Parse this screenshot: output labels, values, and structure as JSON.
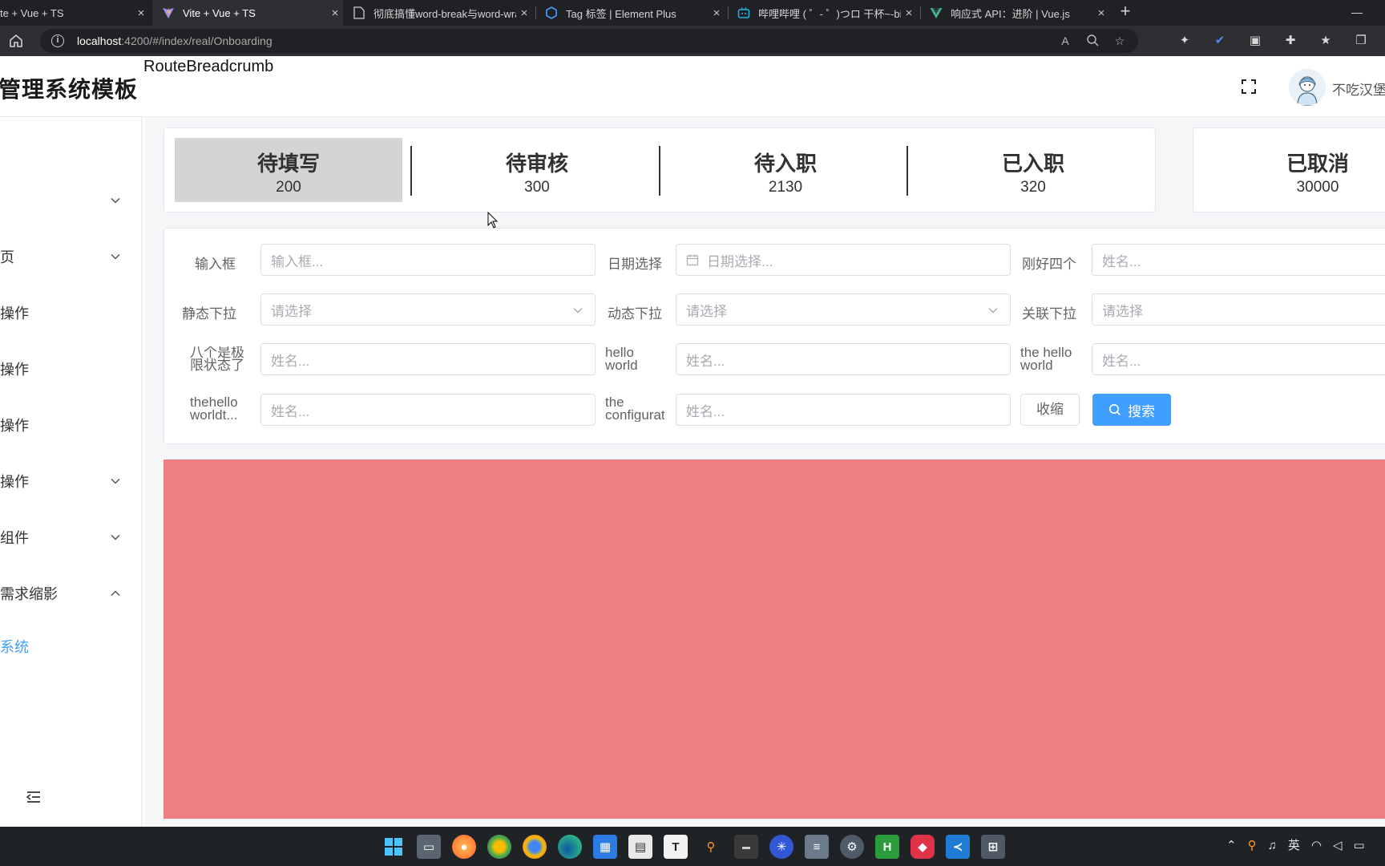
{
  "browser": {
    "tabs": [
      {
        "title": "te + Vue + TS",
        "icon": "vite-icon",
        "active": false
      },
      {
        "title": "Vite + Vue + TS",
        "icon": "vite-icon",
        "active": true
      },
      {
        "title": "彻底搞懂word-break与word-wra",
        "icon": "document-icon",
        "active": false
      },
      {
        "title": "Tag 标签 | Element Plus",
        "icon": "element-plus-icon",
        "active": false
      },
      {
        "title": "哔哩哔哩 ( ゜- ゜)つロ 干杯~-bilib",
        "icon": "bilibili-icon",
        "active": false
      },
      {
        "title": "响应式 API：进阶 | Vue.js",
        "icon": "vue-icon",
        "active": false
      }
    ],
    "url_host": "localhost",
    "url_path": ":4200/#/index/real/Onboarding"
  },
  "header": {
    "app_title": "管理系统模板",
    "breadcrumb": "RouteBreadcrumb",
    "username": "不吃汉堡"
  },
  "sidebar": {
    "items": [
      {
        "label": "",
        "has_arrow": false
      },
      {
        "label": "",
        "has_arrow": true,
        "expanded": false
      },
      {
        "label": "页",
        "has_arrow": true,
        "expanded": false
      },
      {
        "label": "操作",
        "has_arrow": false
      },
      {
        "label": "操作",
        "has_arrow": false
      },
      {
        "label": "操作",
        "has_arrow": false
      },
      {
        "label": "操作",
        "has_arrow": true,
        "expanded": false
      },
      {
        "label": "组件",
        "has_arrow": true,
        "expanded": false
      },
      {
        "label": "需求缩影",
        "has_arrow": true,
        "expanded": true
      },
      {
        "label": "系统",
        "has_arrow": false,
        "link": true
      }
    ]
  },
  "status_tabs": [
    {
      "label": "待填写",
      "count": "200",
      "active": true
    },
    {
      "label": "待审核",
      "count": "300",
      "active": false
    },
    {
      "label": "待入职",
      "count": "2130",
      "active": false
    },
    {
      "label": "已入职",
      "count": "320",
      "active": false
    },
    {
      "label": "已取消",
      "count": "30000",
      "active": false
    }
  ],
  "filters": {
    "row1": [
      {
        "label": "输入框",
        "placeholder": "输入框..."
      },
      {
        "label": "日期选择",
        "placeholder": "日期选择..."
      },
      {
        "label": "刚好四个",
        "placeholder": "姓名..."
      }
    ],
    "row2": [
      {
        "label": "静态下拉",
        "placeholder": "请选择"
      },
      {
        "label": "动态下拉",
        "placeholder": "请选择"
      },
      {
        "label": "关联下拉",
        "placeholder": "请选择"
      }
    ],
    "row3": [
      {
        "label": "八个是极限状态了",
        "placeholder": "姓名..."
      },
      {
        "label": "hello world",
        "placeholder": "姓名..."
      },
      {
        "label": "the hello world",
        "placeholder": "姓名..."
      }
    ],
    "row4": [
      {
        "label": "thehello worldt...",
        "placeholder": "姓名..."
      },
      {
        "label": "the configurati...",
        "placeholder": "姓名..."
      }
    ],
    "collapse_label": "收缩",
    "search_label": "搜索"
  },
  "colors": {
    "primary": "#409eff",
    "content_block": "#ed7f80",
    "active_tab_bg": "#d4d4d7"
  },
  "taskbar": {
    "icons": [
      "windows-start-icon",
      "file-explorer-icon",
      "firefox-icon",
      "chrome-canary-icon",
      "chrome-icon",
      "edge-icon",
      "calendar-icon",
      "notepad-icon",
      "typora-icon",
      "search-tool-icon",
      "terminal-icon",
      "network-icon",
      "database-icon",
      "settings-icon",
      "hbuilder-icon",
      "shield-app-icon",
      "vscode-icon",
      "calculator-icon"
    ],
    "ime_label": "英"
  }
}
